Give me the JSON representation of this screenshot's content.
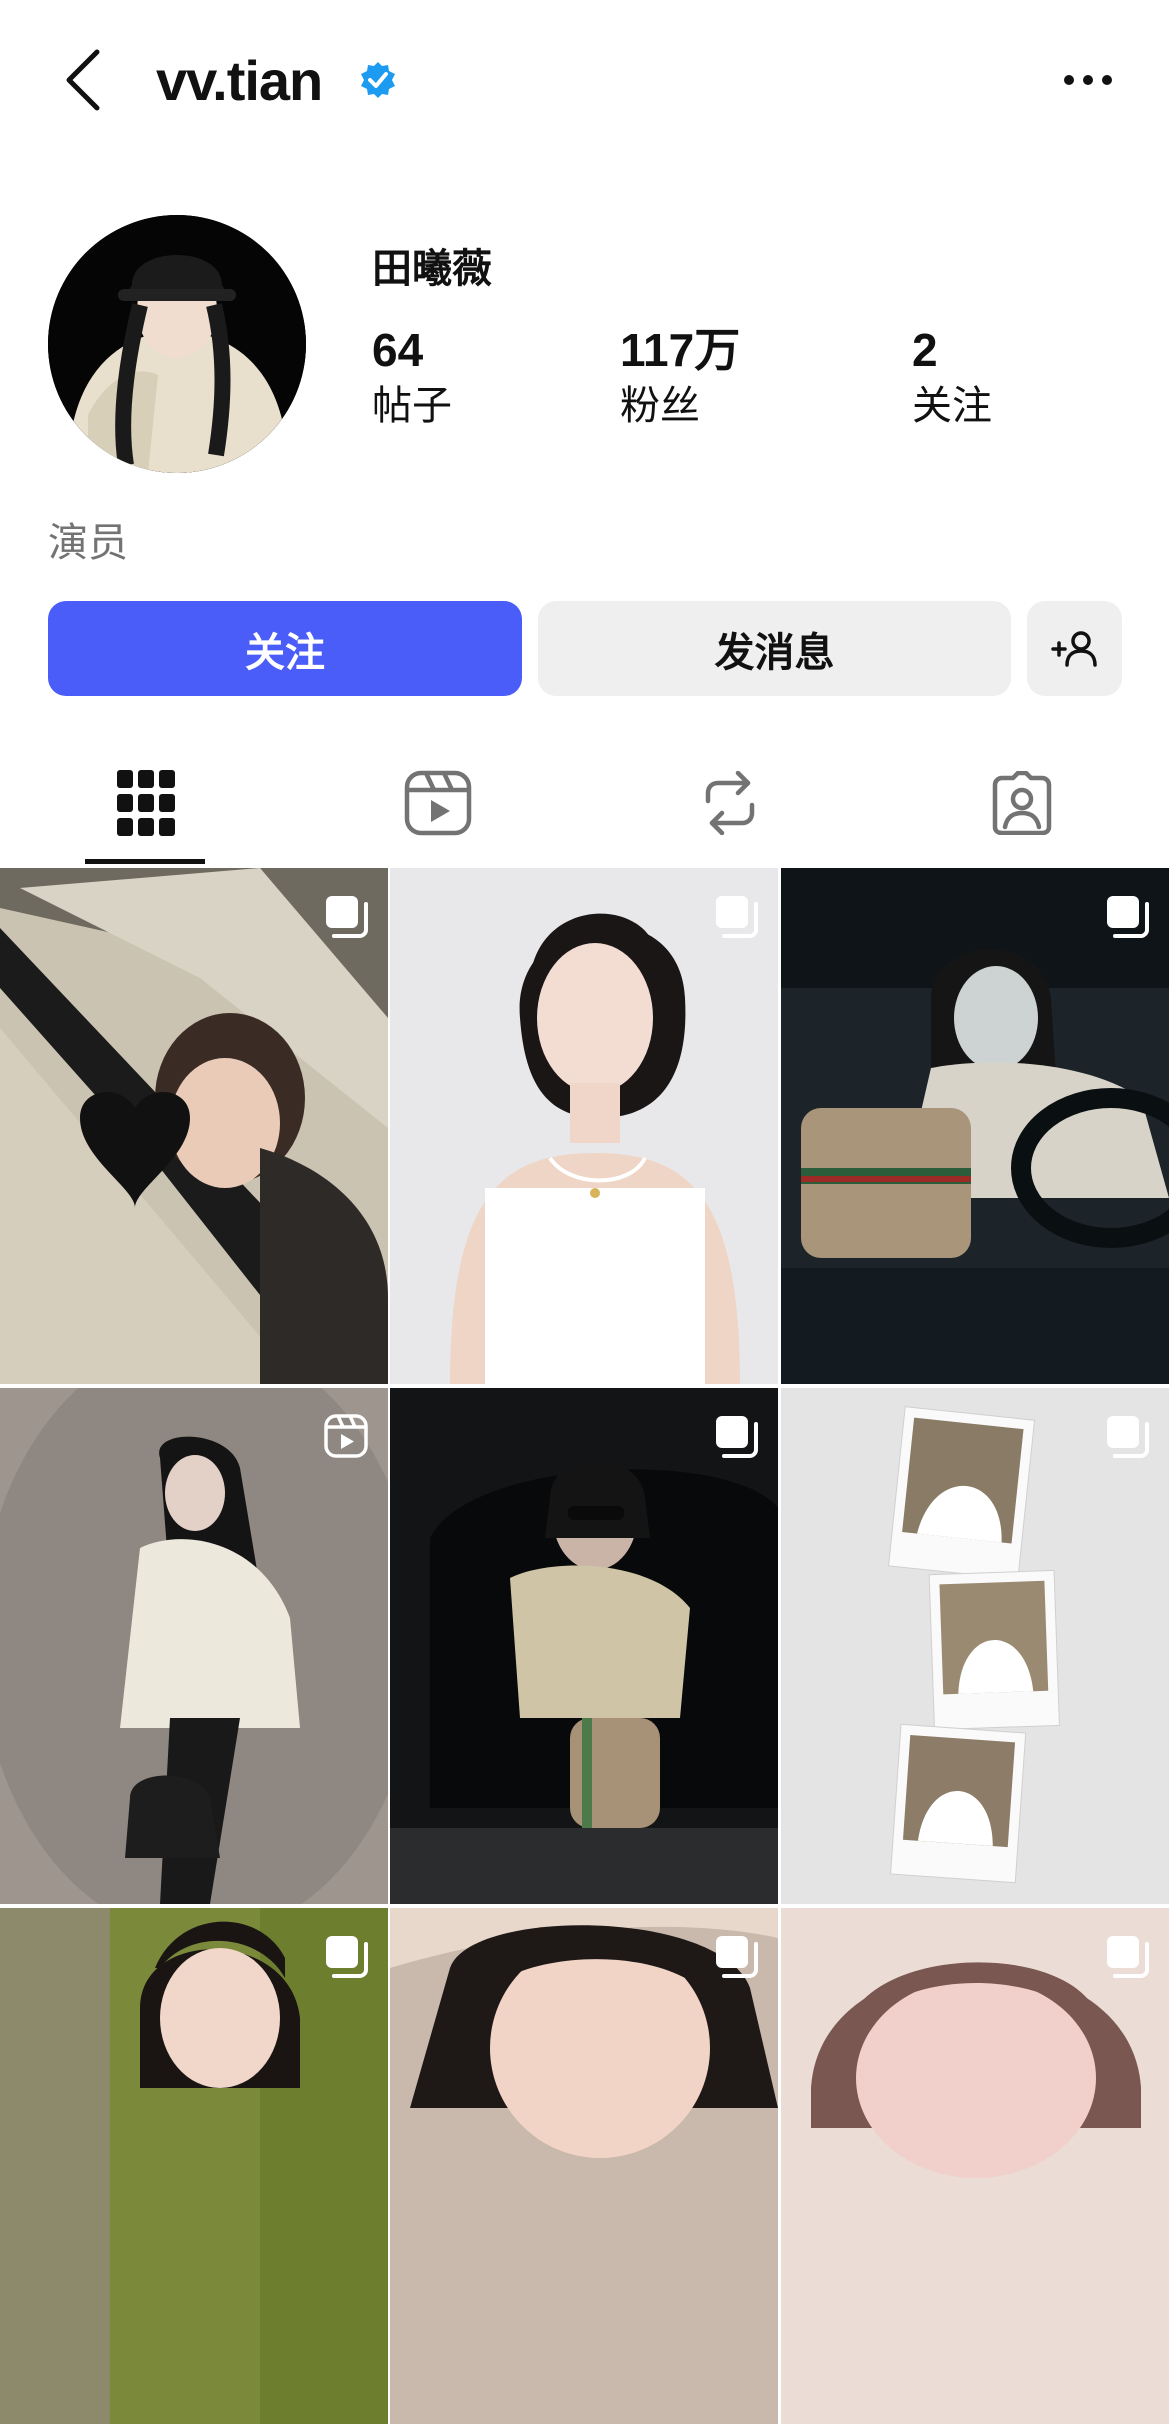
{
  "header": {
    "username": "vv.tian"
  },
  "profile": {
    "display_name": "田曦薇",
    "stats": [
      {
        "value": "64",
        "label": "帖子"
      },
      {
        "value": "117万",
        "label": "粉丝"
      },
      {
        "value": "2",
        "label": "关注"
      }
    ],
    "bio": "演员"
  },
  "buttons": {
    "follow": "关注",
    "message": "发消息"
  },
  "tabs": [
    "posts-grid",
    "reels",
    "reposts",
    "tagged"
  ],
  "colors": {
    "accent": "#4a5df9",
    "verified": "#1d9bf0",
    "secondary_text": "#737373",
    "button_gray": "#efefef"
  },
  "grid": {
    "posts": [
      {
        "type": "carousel",
        "icon": "multi-post-icon"
      },
      {
        "type": "carousel",
        "icon": "multi-post-icon"
      },
      {
        "type": "carousel",
        "icon": "multi-post-icon"
      },
      {
        "type": "reel",
        "icon": "reel-icon"
      },
      {
        "type": "carousel",
        "icon": "multi-post-icon"
      },
      {
        "type": "carousel",
        "icon": "multi-post-icon"
      },
      {
        "type": "carousel",
        "icon": "multi-post-icon"
      },
      {
        "type": "carousel",
        "icon": "multi-post-icon"
      },
      {
        "type": "carousel",
        "icon": "multi-post-icon"
      }
    ]
  }
}
